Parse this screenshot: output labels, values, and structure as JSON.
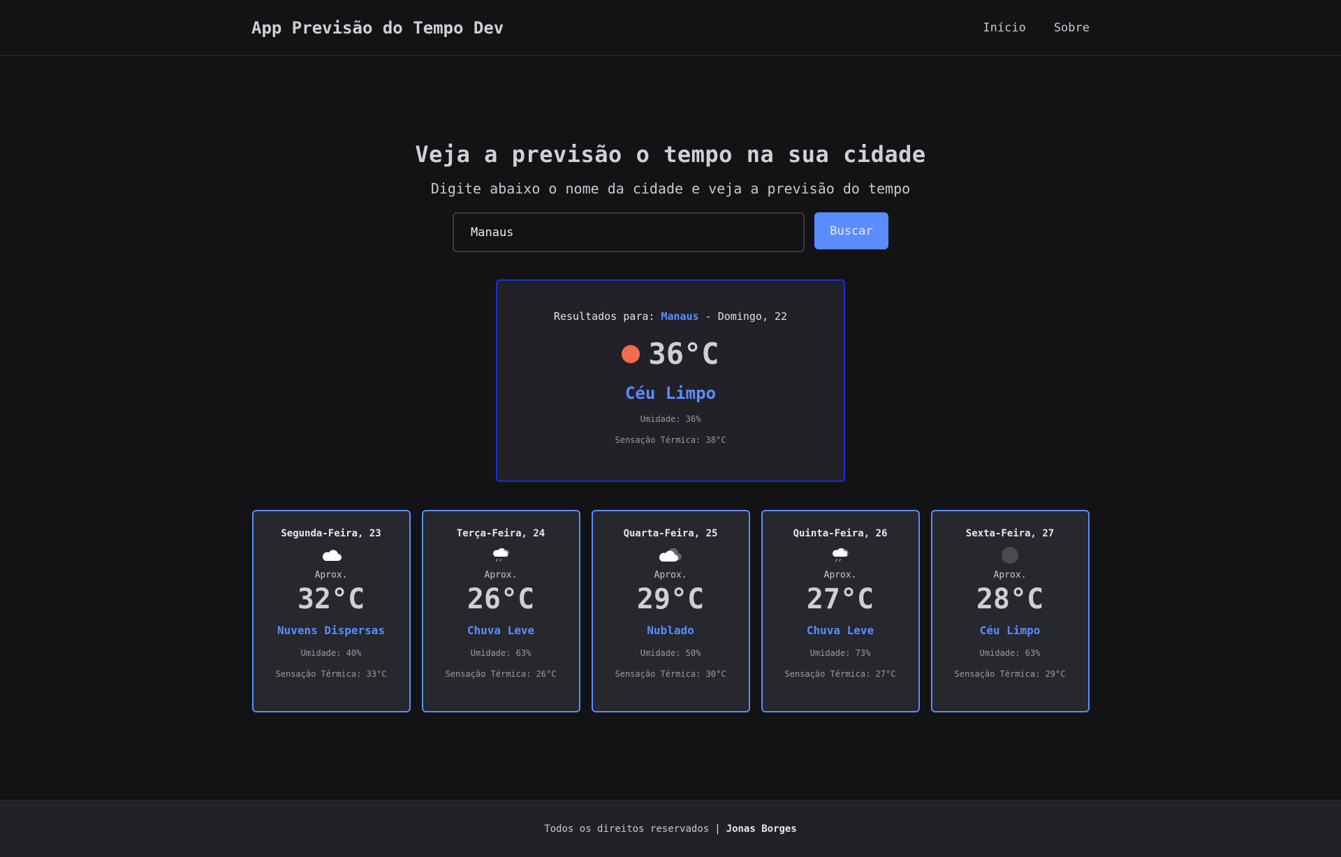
{
  "header": {
    "brand": "App Previsão do Tempo Dev",
    "nav": [
      "Início",
      "Sobre"
    ]
  },
  "hero": {
    "title": "Veja a previsão o tempo na sua cidade",
    "subtitle": "Digite abaixo o nome da cidade e veja a previsão do tempo"
  },
  "search": {
    "value": "Manaus",
    "button_label": "Buscar"
  },
  "today": {
    "prefix": "Resultados para:",
    "city": "Manaus",
    "date": "- Domingo, 22",
    "icon": "sun-icon",
    "temp": "36°C",
    "condition": "Céu Limpo",
    "humidity": "Umidade: 36%",
    "feels_like": "Sensação Térmica: 38°C"
  },
  "forecast": [
    {
      "day": "Segunda-Feira, 23",
      "icon": "cloud-icon",
      "aprox": "Aprox.",
      "temp": "32°C",
      "condition": "Nuvens Dispersas",
      "humidity": "Umidade: 40%",
      "feels_like": "Sensação Térmica: 33°C"
    },
    {
      "day": "Terça-Feira, 24",
      "icon": "rain-cloud-icon",
      "aprox": "Aprox.",
      "temp": "26°C",
      "condition": "Chuva Leve",
      "humidity": "Umidade: 63%",
      "feels_like": "Sensação Térmica: 26°C"
    },
    {
      "day": "Quarta-Feira, 25",
      "icon": "overcast-cloud-icon",
      "aprox": "Aprox.",
      "temp": "29°C",
      "condition": "Nublado",
      "humidity": "Umidade: 50%",
      "feels_like": "Sensação Térmica: 30°C"
    },
    {
      "day": "Quinta-Feira, 26",
      "icon": "rain-cloud-icon",
      "aprox": "Aprox.",
      "temp": "27°C",
      "condition": "Chuva Leve",
      "humidity": "Umidade: 73%",
      "feels_like": "Sensação Térmica: 27°C"
    },
    {
      "day": "Sexta-Feira, 27",
      "icon": "clear-night-icon",
      "aprox": "Aprox.",
      "temp": "28°C",
      "condition": "Céu Limpo",
      "humidity": "Umidade: 63%",
      "feels_like": "Sensação Térmica: 29°C"
    }
  ],
  "footer": {
    "text": "Todos os direitos reservados",
    "separator": "|",
    "author": "Jonas Borges"
  },
  "colors": {
    "accent": "#5b8cff",
    "today_border": "#1a2fd6",
    "sun": "#f26b4a",
    "background": "#131316",
    "card": "#27272e"
  }
}
